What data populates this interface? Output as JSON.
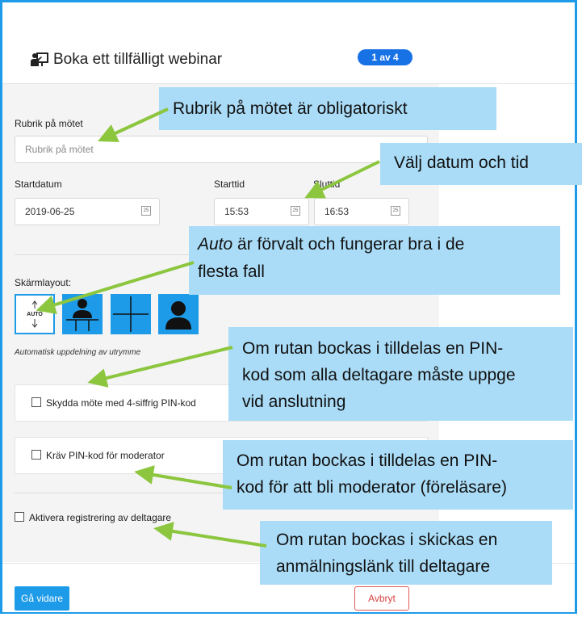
{
  "dialog": {
    "title": "Boka ett tillfälligt webinar",
    "step_badge": "1 av 4",
    "title_icon": "presenter-board-icon"
  },
  "form": {
    "subject_label": "Rubrik på mötet",
    "subject_placeholder": "Rubrik på mötet",
    "start_date_label": "Startdatum",
    "start_date_value": "2019-06-25",
    "start_time_label": "Starttid",
    "start_time_value": "15:53",
    "end_time_label": "Sluttid",
    "end_time_value": "16:53",
    "screen_layout_label": "Skärmlayout:",
    "layout_options": [
      {
        "name": "auto",
        "label": "AUTO"
      },
      {
        "name": "presenter-with-grid",
        "label": ""
      },
      {
        "name": "grid-four",
        "label": ""
      },
      {
        "name": "single-speaker",
        "label": ""
      }
    ],
    "layout_hint": "Automatisk uppdelning av utrymme",
    "pin_checkbox_label": "Skydda möte med 4-siffrig PIN-kod",
    "moderator_pin_label": "Kräv PIN-kod för moderator",
    "registration_label": "Aktivera registrering av deltagare"
  },
  "footer": {
    "next_button": "Gå vidare",
    "cancel_button": "Avbryt"
  },
  "callouts": {
    "subject": "Rubrik på mötet är obligatoriskt",
    "datetime": "Välj datum och tid",
    "auto_line1_em": "Auto",
    "auto_line1_rest": " är förvalt och fungerar bra i de",
    "auto_line2": "flesta fall",
    "pin_line1": "Om rutan bockas i tilldelas en PIN-",
    "pin_line2": "kod som alla deltagare måste uppge",
    "pin_line3": "vid anslutning",
    "mod_line1": "Om rutan bockas i tilldelas en PIN-",
    "mod_line2": "kod för att bli moderator (föreläsare)",
    "reg_line1": "Om rutan bockas i skickas en",
    "reg_line2": "anmälningslänk till deltagare"
  },
  "colors": {
    "accent": "#1e9be8",
    "callout_bg": "#aadcf7",
    "arrow": "#8cc63f",
    "badge": "#1772e6",
    "cancel": "#d84444"
  }
}
